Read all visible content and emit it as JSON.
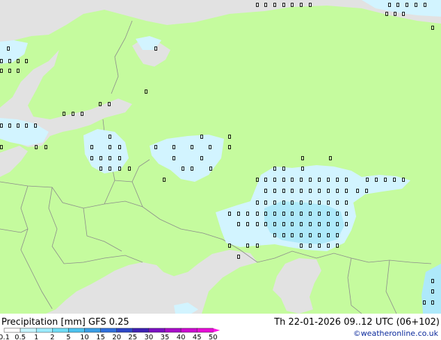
{
  "title": {
    "left": "Precipitation [mm]  GFS 0.25",
    "right": "Th 22-01-2026 09..12 UTC (06+102)"
  },
  "credit": "©weatheronline.co.uk",
  "legend": {
    "labels": [
      "0.1",
      "0.5",
      "1",
      "2",
      "5",
      "10",
      "15",
      "20",
      "25",
      "30",
      "35",
      "40",
      "45",
      "50"
    ],
    "colors": [
      "#ffffff",
      "#c6f5ff",
      "#9cecff",
      "#6fdcf5",
      "#4cc3ef",
      "#3a9ee6",
      "#2f6fdc",
      "#2d46c7",
      "#3d1fb3",
      "#7a10c2",
      "#a80bc9",
      "#cc0ad0",
      "#e60cd6"
    ],
    "arrow_color": "#ff14e6"
  },
  "colors": {
    "land": "#c5fb9e",
    "sea": "#e2e2e2",
    "border": "#8a8a8a",
    "precip_light": "#d2f4ff",
    "precip_medium": "#aee9fa"
  }
}
